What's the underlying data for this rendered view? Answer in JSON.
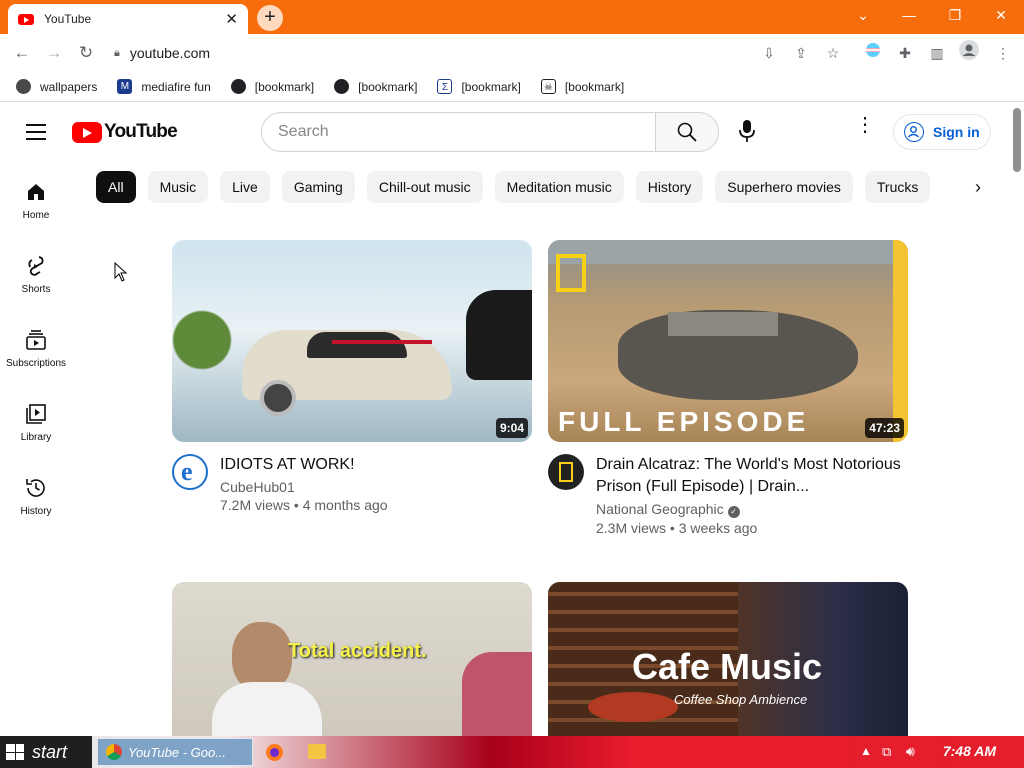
{
  "browser": {
    "tab_title": "YouTube",
    "tab_close": "✕",
    "new_tab": "+",
    "url": "youtube.com",
    "window_controls": [
      "⌄",
      "—",
      "❐",
      "✕"
    ]
  },
  "bookmarks": [
    {
      "label": "wallpapers",
      "icon": "wallpaper-icon",
      "color": "#4a4a4a"
    },
    {
      "label": "mediafire fun",
      "icon": "mediafire-icon",
      "color": "#1b3b8f"
    },
    {
      "label": "[bookmark]",
      "icon": "globe-icon",
      "color": "#202124"
    },
    {
      "label": "[bookmark]",
      "icon": "globe-icon",
      "color": "#202124"
    },
    {
      "label": "[bookmark]",
      "icon": "sigma-icon",
      "color": "#1b3b8f"
    },
    {
      "label": "[bookmark]",
      "icon": "skull-icon",
      "color": "#202124"
    }
  ],
  "header": {
    "logo_text": "YouTube",
    "search_placeholder": "Search",
    "signin_label": "Sign in",
    "brand_red": "#ff0000",
    "link_blue": "#065fd4"
  },
  "sidebar": {
    "items": [
      {
        "label": "Home",
        "icon": "home-icon"
      },
      {
        "label": "Shorts",
        "icon": "shorts-icon"
      },
      {
        "label": "Subscriptions",
        "icon": "subscriptions-icon"
      },
      {
        "label": "Library",
        "icon": "library-icon"
      },
      {
        "label": "History",
        "icon": "history-icon"
      }
    ]
  },
  "chips": [
    "All",
    "Music",
    "Live",
    "Gaming",
    "Chill-out music",
    "Meditation music",
    "History",
    "Superhero movies",
    "Trucks"
  ],
  "videos": [
    {
      "title": "IDIOTS AT WORK!",
      "channel": "CubeHub01",
      "views": "7.2M views",
      "age": "4 months ago",
      "duration": "9:04",
      "verified": false
    },
    {
      "title": "Drain Alcatraz: The World's Most Notorious Prison (Full Episode) | Drain...",
      "channel": "National Geographic",
      "views": "2.3M views",
      "age": "3 weeks ago",
      "duration": "47:23",
      "verified": true,
      "overlay": "FULL EPISODE"
    },
    {
      "title": "",
      "overlay": "Total accident."
    },
    {
      "title": "",
      "overlay": "Cafe Music",
      "overlay_sub": "Coffee Shop Ambience"
    }
  ],
  "taskbar": {
    "start_label": "start",
    "task_label": "YouTube - Goo...",
    "clock": "7:48 AM"
  }
}
